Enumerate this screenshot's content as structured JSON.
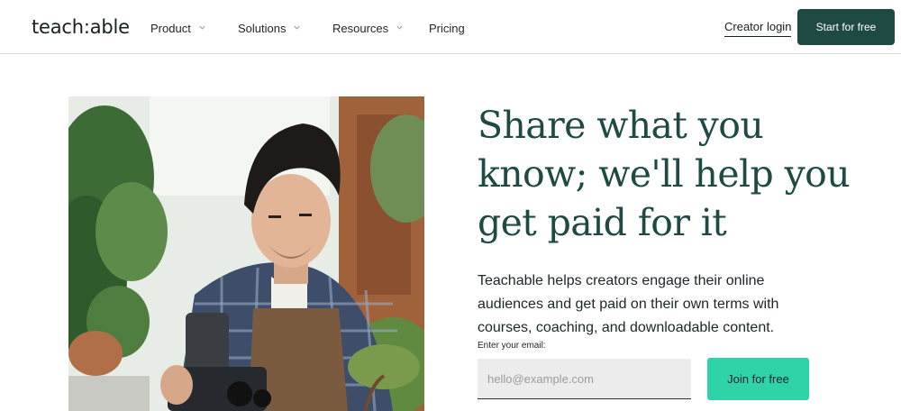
{
  "header": {
    "logo": "teach:able",
    "nav": [
      {
        "label": "Product",
        "has_dropdown": true
      },
      {
        "label": "Solutions",
        "has_dropdown": true
      },
      {
        "label": "Resources",
        "has_dropdown": true
      },
      {
        "label": "Pricing",
        "has_dropdown": false
      }
    ],
    "creator_login": "Creator login",
    "start_button": "Start for free"
  },
  "hero": {
    "headline": "Share what you know; we'll help you get paid for it",
    "subheading": "Teachable helps creators engage their online audiences and get paid on their own terms with courses, coaching, and downloadable content.",
    "email_label": "Enter your email:",
    "email_placeholder": "hello@example.com",
    "join_button": "Join for free"
  },
  "colors": {
    "brand_dark": "#1f4a44",
    "accent_green": "#2fd3a8",
    "text": "#1c2626"
  }
}
